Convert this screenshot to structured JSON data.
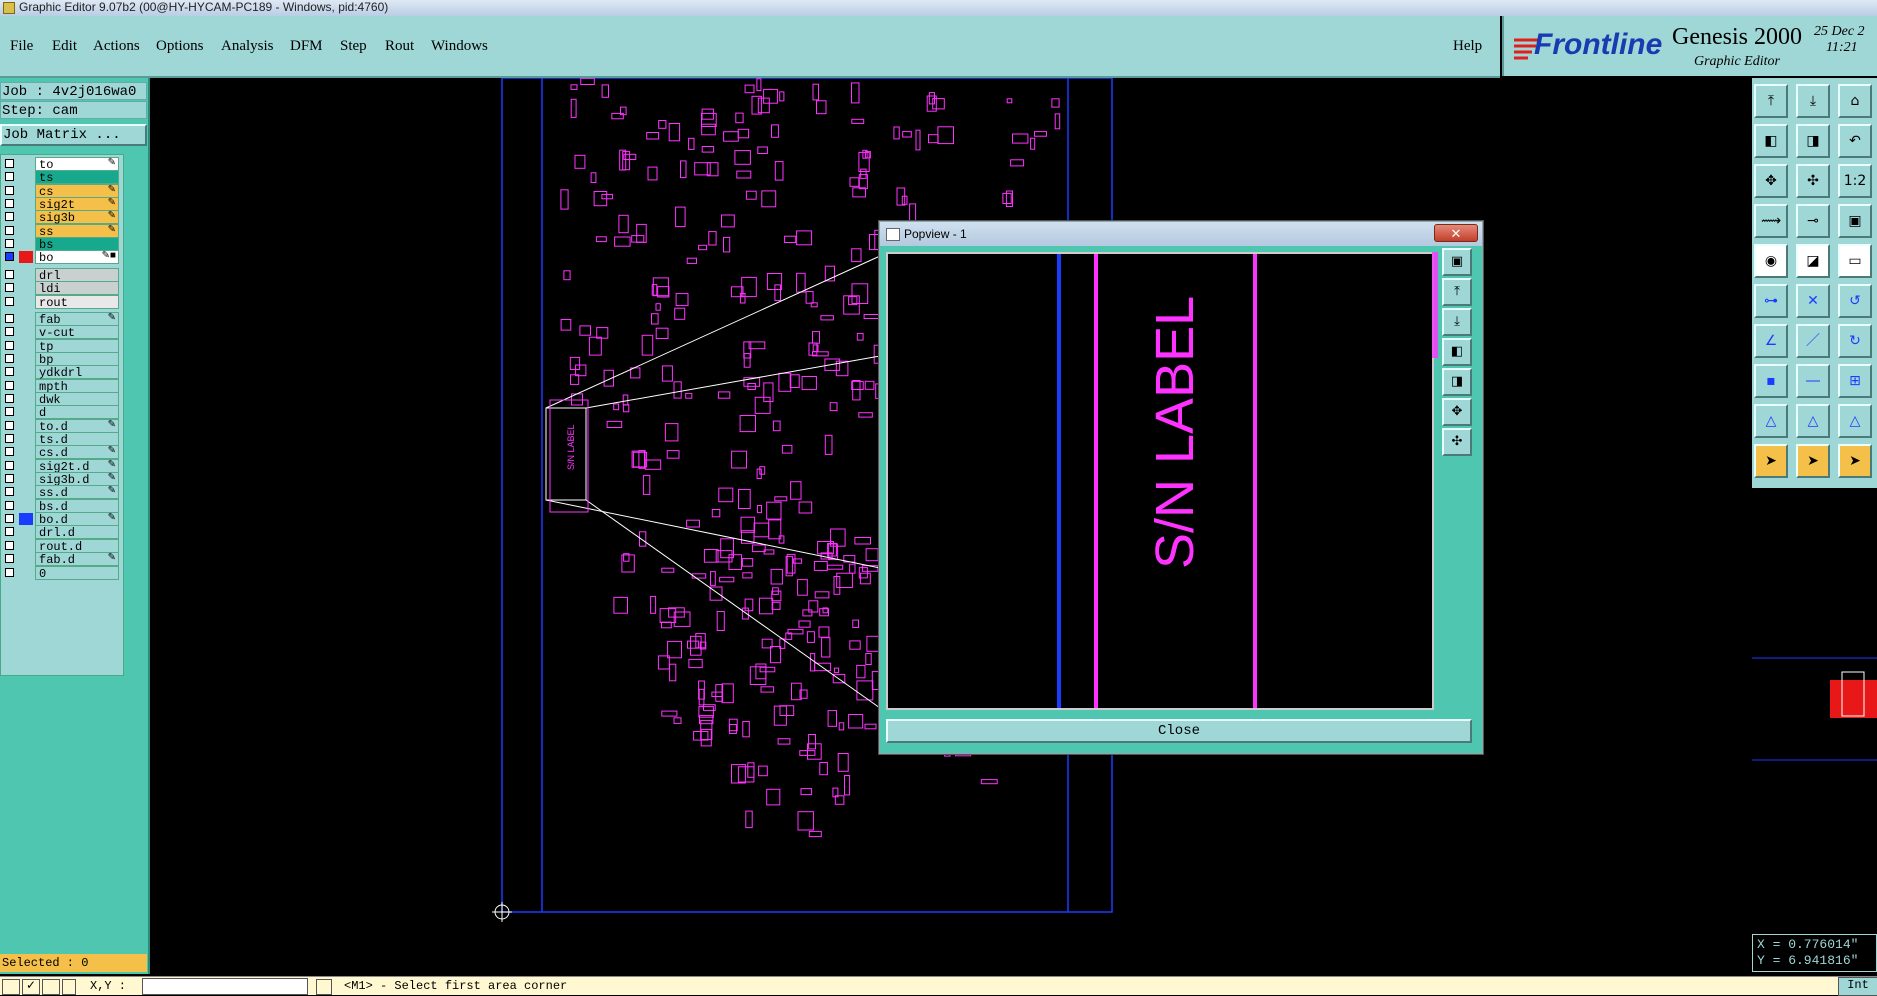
{
  "window": {
    "title": "Graphic Editor 9.07b2 (00@HY-HYCAM-PC189 - Windows, pid:4760)"
  },
  "menu": [
    "File",
    "Edit",
    "Actions",
    "Options",
    "Analysis",
    "DFM",
    "Step",
    "Rout",
    "Windows"
  ],
  "help": "Help",
  "brand": {
    "logo": "Frontline",
    "product": "Genesis 2000",
    "subtitle": "Graphic Editor",
    "date": "25 Dec 2",
    "time": "11:21"
  },
  "job": {
    "job_label": "Job : 4v2j016wa0",
    "step_label": "Step: cam",
    "matrix_button": "Job Matrix ..."
  },
  "layers": [
    {
      "name": "to",
      "color": "#ffffff",
      "flag": "✎"
    },
    {
      "name": "ts",
      "color": "#17a98e",
      "flag": ""
    },
    {
      "name": "cs",
      "color": "#f4c04a",
      "flag": "✎"
    },
    {
      "name": "sig2t",
      "color": "#f4c04a",
      "flag": "✎"
    },
    {
      "name": "sig3b",
      "color": "#f4c04a",
      "flag": "✎"
    },
    {
      "name": "ss",
      "color": "#f4c04a",
      "flag": "✎"
    },
    {
      "name": "bs",
      "color": "#17a98e",
      "flag": ""
    },
    {
      "name": "bo",
      "color": "#ffffff",
      "flag": "✎■",
      "active": true
    },
    {
      "name": "drl",
      "color": "#c8d0d0",
      "flag": ""
    },
    {
      "name": "ldi",
      "color": "#c8d0d0",
      "flag": ""
    },
    {
      "name": "rout",
      "color": "#e8e8e8",
      "flag": ""
    },
    {
      "name": "fab",
      "color": "#9fd6d6",
      "flag": "✎"
    },
    {
      "name": "v-cut",
      "color": "#9fd6d6",
      "flag": ""
    },
    {
      "name": "tp",
      "color": "#9fd6d6",
      "flag": ""
    },
    {
      "name": "bp",
      "color": "#9fd6d6",
      "flag": ""
    },
    {
      "name": "ydkdrl",
      "color": "#9fd6d6",
      "flag": ""
    },
    {
      "name": "mpth",
      "color": "#9fd6d6",
      "flag": ""
    },
    {
      "name": "dwk",
      "color": "#9fd6d6",
      "flag": ""
    },
    {
      "name": "d",
      "color": "#9fd6d6",
      "flag": ""
    },
    {
      "name": "to.d",
      "color": "#9fd6d6",
      "flag": "✎"
    },
    {
      "name": "ts.d",
      "color": "#9fd6d6",
      "flag": ""
    },
    {
      "name": "cs.d",
      "color": "#9fd6d6",
      "flag": "✎"
    },
    {
      "name": "sig2t.d",
      "color": "#9fd6d6",
      "flag": "✎"
    },
    {
      "name": "sig3b.d",
      "color": "#9fd6d6",
      "flag": "✎"
    },
    {
      "name": "ss.d",
      "color": "#9fd6d6",
      "flag": "✎"
    },
    {
      "name": "bs.d",
      "color": "#9fd6d6",
      "flag": ""
    },
    {
      "name": "bo.d",
      "color": "#9fd6d6",
      "flag": "✎",
      "swatch": "#1a3cff"
    },
    {
      "name": "drl.d",
      "color": "#9fd6d6",
      "flag": ""
    },
    {
      "name": "rout.d",
      "color": "#9fd6d6",
      "flag": ""
    },
    {
      "name": "fab.d",
      "color": "#9fd6d6",
      "flag": "✎"
    },
    {
      "name": "0",
      "color": "#9fd6d6",
      "flag": ""
    }
  ],
  "selected": "Selected : 0",
  "popview": {
    "title": "Popview - 1",
    "close_x": "✕",
    "label_text": "S/N LABEL",
    "close_button": "Close"
  },
  "board": {
    "label_text": "S/N LABEL"
  },
  "coords": {
    "x": "X = 0.776014\"",
    "y": "Y = 6.941816\""
  },
  "status": {
    "xy_label": "X,Y :",
    "xy_value": "",
    "prompt": "<M1> - Select first area corner",
    "right_button": "Int"
  },
  "colors": {
    "magenta": "#ff33ff",
    "blue": "#1a3cff",
    "panel": "#9fd6d6",
    "teal": "#4fc7b0",
    "orange": "#f4c04a"
  }
}
